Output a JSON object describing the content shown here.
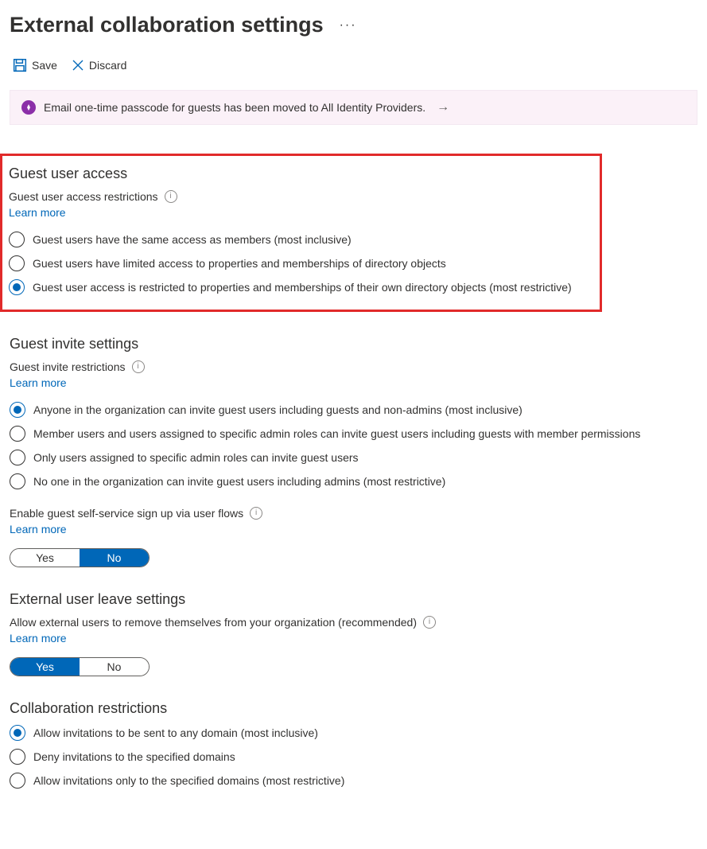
{
  "title": "External collaboration settings",
  "toolbar": {
    "save": "Save",
    "discard": "Discard"
  },
  "banner": {
    "text": "Email one-time passcode for guests has been moved to All Identity Providers."
  },
  "learn_more": "Learn more",
  "toggle": {
    "yes": "Yes",
    "no": "No"
  },
  "guest_access": {
    "heading": "Guest user access",
    "subheading": "Guest user access restrictions",
    "selected": 2,
    "options": [
      "Guest users have the same access as members (most inclusive)",
      "Guest users have limited access to properties and memberships of directory objects",
      "Guest user access is restricted to properties and memberships of their own directory objects (most restrictive)"
    ]
  },
  "guest_invite": {
    "heading": "Guest invite settings",
    "subheading": "Guest invite restrictions",
    "selected": 0,
    "options": [
      "Anyone in the organization can invite guest users including guests and non-admins (most inclusive)",
      "Member users and users assigned to specific admin roles can invite guest users including guests with member permissions",
      "Only users assigned to specific admin roles can invite guest users",
      "No one in the organization can invite guest users including admins (most restrictive)"
    ],
    "self_service_label": "Enable guest self-service sign up via user flows",
    "self_service_value": "No"
  },
  "leave": {
    "heading": "External user leave settings",
    "subheading": "Allow external users to remove themselves from your organization (recommended)",
    "value": "Yes"
  },
  "collab": {
    "heading": "Collaboration restrictions",
    "selected": 0,
    "options": [
      "Allow invitations to be sent to any domain (most inclusive)",
      "Deny invitations to the specified domains",
      "Allow invitations only to the specified domains (most restrictive)"
    ]
  }
}
